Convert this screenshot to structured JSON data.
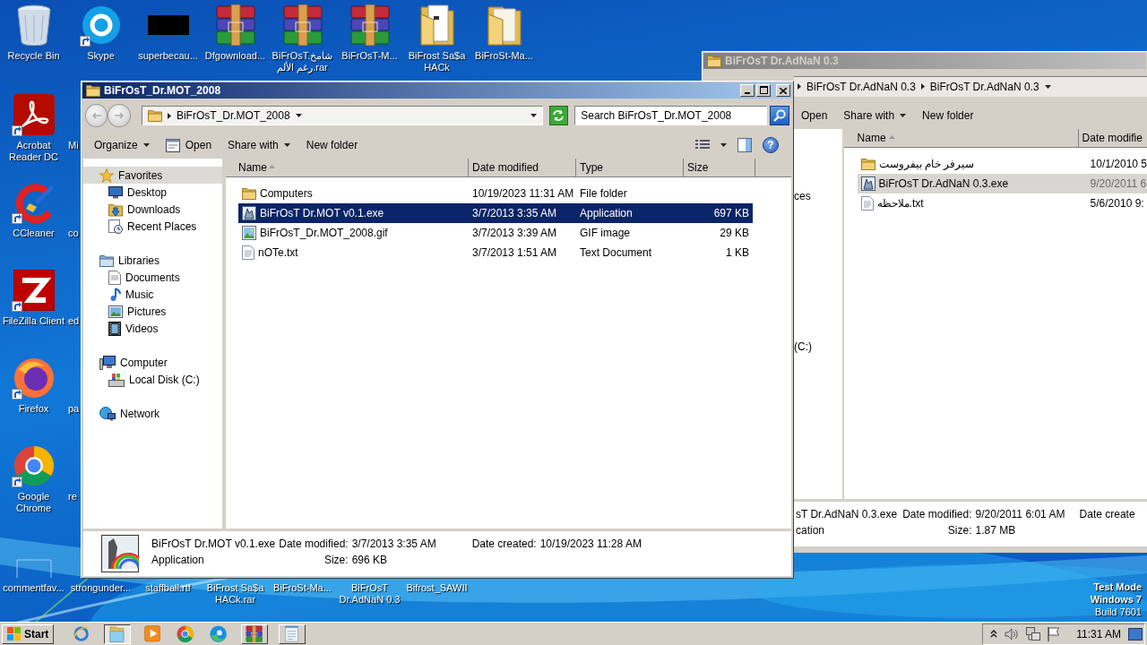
{
  "desktop": {
    "top_icons": [
      {
        "label": "Recycle Bin",
        "kind": "recycle",
        "shortcut": false
      },
      {
        "label": "Skype",
        "kind": "skype",
        "shortcut": true
      },
      {
        "label": "superbecau...",
        "kind": "thumb",
        "shortcut": false
      },
      {
        "label": "Dfgownload...",
        "kind": "rar",
        "shortcut": false
      },
      {
        "label": "BiFrOsT.شامخ رغم الألم.rar",
        "kind": "rar",
        "shortcut": false
      },
      {
        "label": "BiFrOsT-M...",
        "kind": "rar",
        "shortcut": false
      },
      {
        "label": "BiFrost Sa$a HACk",
        "kind": "folderdoc",
        "shortcut": false
      },
      {
        "label": "BiFroSt-Ma...",
        "kind": "folder",
        "shortcut": false
      }
    ],
    "left_icons": [
      {
        "label": "Acrobat Reader DC",
        "kind": "acrobat",
        "shortcut": true
      },
      {
        "label": "CCleaner",
        "kind": "ccleaner",
        "shortcut": true
      },
      {
        "label": "FileZilla Client",
        "kind": "filezilla",
        "shortcut": true
      },
      {
        "label": "Firefox",
        "kind": "firefox",
        "shortcut": true
      },
      {
        "label": "Google Chrome",
        "kind": "chrome",
        "shortcut": true
      }
    ],
    "cut_labels": [
      "Mi",
      "co",
      "ed",
      "pa",
      "re"
    ],
    "bottom_icons": [
      {
        "label": "commentfav...",
        "kind": "blank"
      },
      {
        "label": "strongunder..."
      },
      {
        "label": "staffball.rtf"
      },
      {
        "label": "BiFrost Sa$a HACk.rar"
      },
      {
        "label": "BiFroSt-Ma..."
      },
      {
        "label": "BiFrOsT Dr.AdNaN 0.3"
      },
      {
        "label": "Bifrost_SAWII"
      }
    ],
    "os_notice": [
      "Test Mode",
      "Windows 7",
      "Build 7601"
    ]
  },
  "back_window": {
    "title": "BiFrOsT Dr.AdNaN 0.3",
    "breadcrumb": [
      "BiFrOsT Dr.AdNaN 0.3",
      "BiFrOsT Dr.AdNaN 0.3"
    ],
    "toolbar": [
      {
        "label": "Open",
        "kind": "plain"
      },
      {
        "label": "Share with",
        "kind": "menu"
      },
      {
        "label": "New folder",
        "kind": "plain"
      }
    ],
    "nav_fragments": [
      "ces",
      "(C:)"
    ],
    "columns": [
      "Name",
      "Date modifie"
    ],
    "rows": [
      {
        "name": "سيرفر خام بيفروست",
        "kind": "folder",
        "date": "10/1/2010 5",
        "selected": false
      },
      {
        "name": "BiFrOsT Dr.AdNaN 0.3.exe",
        "kind": "exe",
        "date": "9/20/2011 6",
        "selected": true
      },
      {
        "name": "ملاحظه.txt",
        "kind": "txt",
        "date": "5/6/2010 9:",
        "selected": false
      }
    ],
    "details": {
      "name": "sT Dr.AdNaN 0.3.exe",
      "type": "cation",
      "fields": [
        {
          "label": "Date modified:",
          "value": "9/20/2011 6:01 AM"
        },
        {
          "label": "Size:",
          "value": "1.87 MB"
        },
        {
          "label": "Date create"
        }
      ]
    }
  },
  "window": {
    "title": "BiFrOsT_Dr.MOT_2008",
    "address": "BiFrOsT_Dr.MOT_2008",
    "search_placeholder": "Search BiFrOsT_Dr.MOT_2008",
    "help": "?",
    "toolbar": [
      {
        "label": "Organize",
        "kind": "menu"
      },
      {
        "label": "Open",
        "kind": "open"
      },
      {
        "label": "Share with",
        "kind": "menu"
      },
      {
        "label": "New folder",
        "kind": "plain"
      }
    ],
    "nav": [
      {
        "label": "Favorites",
        "kind": "star",
        "selected": true,
        "children": [
          {
            "label": "Desktop",
            "kind": "desktop",
            "selected": false
          },
          {
            "label": "Downloads",
            "kind": "downloads",
            "selected": false
          },
          {
            "label": "Recent Places",
            "kind": "recent",
            "selected": false
          }
        ]
      },
      {
        "label": "Libraries",
        "kind": "libraries",
        "selected": false,
        "children": [
          {
            "label": "Documents",
            "kind": "documents",
            "selected": false
          },
          {
            "label": "Music",
            "kind": "music",
            "selected": false
          },
          {
            "label": "Pictures",
            "kind": "pictures",
            "selected": false
          },
          {
            "label": "Videos",
            "kind": "videos",
            "selected": false
          }
        ]
      },
      {
        "label": "Computer",
        "kind": "computer",
        "selected": false,
        "children": [
          {
            "label": "Local Disk (C:)",
            "kind": "disk",
            "selected": false
          }
        ]
      },
      {
        "label": "Network",
        "kind": "network",
        "selected": false
      }
    ],
    "columns": [
      "Name",
      "Date modified",
      "Type",
      "Size"
    ],
    "rows": [
      {
        "name": "Computers",
        "kind": "folder",
        "date": "10/19/2023 11:31 AM",
        "type": "File folder",
        "selected": false
      },
      {
        "name": "BiFrOsT Dr.MOT v0.1.exe",
        "kind": "exe",
        "date": "3/7/2013 3:35 AM",
        "type": "Application",
        "size": "697 KB",
        "selected": true
      },
      {
        "name": "BiFrOsT_Dr.MOT_2008.gif",
        "kind": "gif",
        "date": "3/7/2013 3:39 AM",
        "type": "GIF image",
        "size": "29 KB",
        "selected": false
      },
      {
        "name": "nOTe.txt",
        "kind": "txt",
        "date": "3/7/2013 1:51 AM",
        "type": "Text Document",
        "size": "1 KB",
        "selected": false
      }
    ],
    "details": {
      "name": "BiFrOsT Dr.MOT v0.1.exe",
      "type": "Application",
      "fields": [
        {
          "label": "Date modified:",
          "value": "3/7/2013 3:35 AM"
        },
        {
          "label": "Size:",
          "value": "696 KB"
        },
        {
          "label": "Date created:",
          "value": "10/19/2023 11:28 AM"
        }
      ]
    }
  },
  "taskbar": {
    "start": "Start",
    "apps": [
      {
        "kind": "ie",
        "running": false,
        "selected": false
      },
      {
        "kind": "explorer",
        "running": true,
        "selected": true
      },
      {
        "kind": "media",
        "running": false,
        "selected": false
      },
      {
        "kind": "chrome",
        "running": false,
        "selected": false
      },
      {
        "kind": "edge",
        "running": false,
        "selected": false
      },
      {
        "kind": "rar",
        "running": true,
        "selected": false
      },
      {
        "kind": "notepad",
        "running": true,
        "selected": false
      }
    ],
    "tray": [
      {
        "kind": "chevron"
      },
      {
        "kind": "speaker"
      },
      {
        "kind": "network"
      },
      {
        "kind": "flag"
      }
    ],
    "clock": "11:31 AM"
  }
}
